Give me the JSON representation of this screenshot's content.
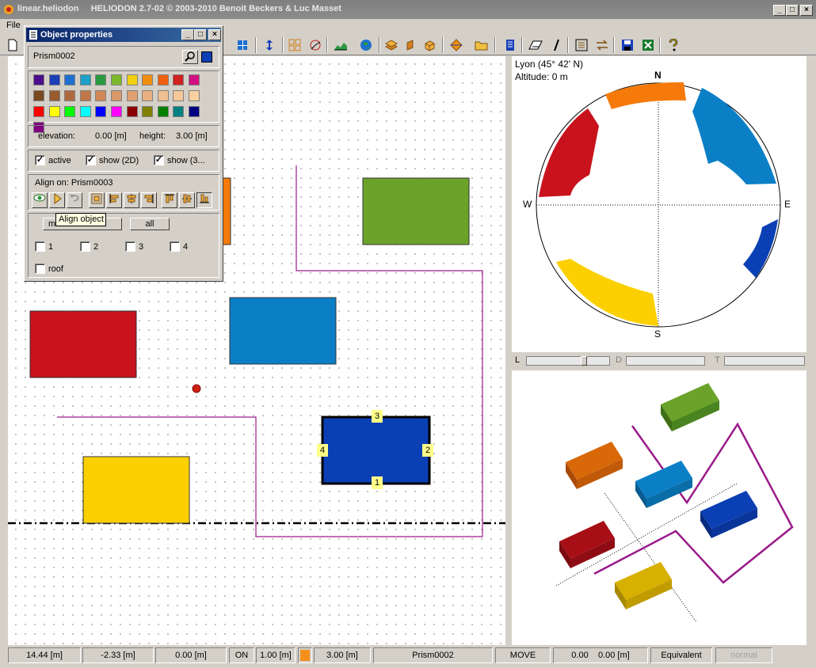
{
  "window": {
    "title": "linear.heliodon",
    "subtitle": "HELIODON 2.7-02 © 2003-2010 Benoit Beckers & Luc Masset"
  },
  "menu": {
    "file": "File"
  },
  "object_properties": {
    "title": "Object properties",
    "name": "Prism0002",
    "elevation_label": "elevation:",
    "elevation_value": "0.00 [m]",
    "height_label": "height:",
    "height_value": "3.00 [m]",
    "active_label": "active",
    "show2d_label": "show (2D)",
    "show3d_label": "show (3...",
    "align_label": "Align on: Prism0003",
    "face_btn_label": "me",
    "all_btn_label": "all",
    "tooltip": "Align object",
    "face_labels": [
      "1",
      "2",
      "3",
      "4"
    ],
    "roof_label": "roof",
    "palette": [
      "#4b0f8c",
      "#1a3fb8",
      "#1e6fd0",
      "#1ea0c8",
      "#2a9a40",
      "#7db82a",
      "#f0d010",
      "#f09010",
      "#f06010",
      "#d02020",
      "#d01080",
      "#7a4a20",
      "#9a5a30",
      "#b06a40",
      "#c07848",
      "#d08858",
      "#d89868",
      "#e0a070",
      "#e8b080",
      "#f0c090",
      "#f4c898",
      "#f8d0a0",
      "#ff0000",
      "#ffff00",
      "#00ff00",
      "#00ffff",
      "#0000ff",
      "#ff00ff",
      "#8b0000",
      "#808000",
      "#008000",
      "#008080",
      "#000080",
      "#800080"
    ]
  },
  "sun_diagram": {
    "location": "Lyon (45° 42' N)",
    "altitude": "Altitude: 0 m",
    "north": "N",
    "south": "S",
    "east": "E",
    "west": "W"
  },
  "sliders": {
    "l": "L",
    "d": "D",
    "t": "T"
  },
  "plan": {
    "edge_labels": [
      "1",
      "2",
      "3",
      "4"
    ],
    "colors": {
      "red": "#c8121c",
      "orange": "#f57a0a",
      "blue": "#0b7fc6",
      "green": "#6ba32a",
      "yellow": "#fcd000",
      "dark_blue": "#0b3fb4"
    }
  },
  "status": {
    "x": "14.44 [m]",
    "y": "-2.33 [m]",
    "z": "0.00 [m]",
    "snap": "ON",
    "grid": "1.00 [m]",
    "height": "3.00 [m]",
    "object": "Prism0002",
    "mode": "MOVE",
    "coord1": "0.00",
    "coord2": "0.00 [m]",
    "projection": "Equivalent",
    "view": "normal"
  }
}
